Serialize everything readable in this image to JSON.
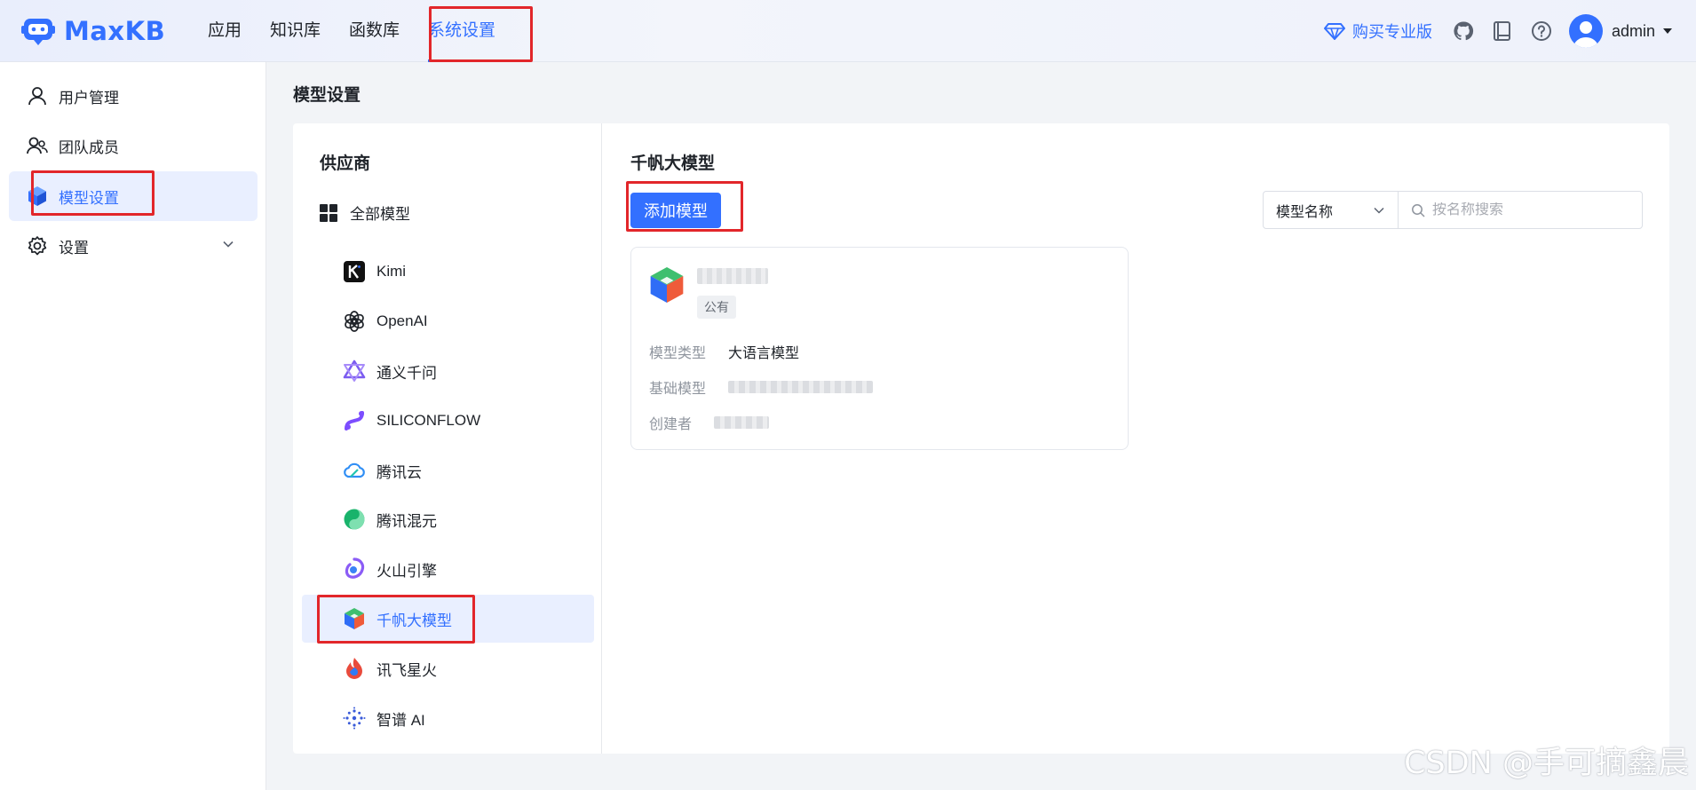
{
  "app": {
    "logo_text": "MaxKB"
  },
  "topnav": {
    "items": [
      {
        "label": "应用"
      },
      {
        "label": "知识库"
      },
      {
        "label": "函数库"
      },
      {
        "label": "系统设置",
        "active": true
      }
    ]
  },
  "header_right": {
    "buy_label": "购买专业版",
    "user_name": "admin",
    "icons": [
      "diamond-icon",
      "github-icon",
      "book-icon",
      "help-icon",
      "avatar-icon",
      "caret-down-icon"
    ]
  },
  "sidebar": {
    "items": [
      {
        "label": "用户管理",
        "icon": "user-icon"
      },
      {
        "label": "团队成员",
        "icon": "team-icon"
      },
      {
        "label": "模型设置",
        "icon": "cube-icon",
        "active": true
      },
      {
        "label": "设置",
        "icon": "gear-icon",
        "expandable": true
      }
    ]
  },
  "main": {
    "page_title": "模型设置",
    "provider_title": "供应商",
    "all_models_label": "全部模型",
    "providers": [
      {
        "label": "Kimi",
        "icon": "kimi-icon"
      },
      {
        "label": "OpenAI",
        "icon": "openai-icon"
      },
      {
        "label": "通义千问",
        "icon": "tongyi-icon"
      },
      {
        "label": "SILICONFLOW",
        "icon": "siliconflow-icon"
      },
      {
        "label": "腾讯云",
        "icon": "tencent-cloud-icon"
      },
      {
        "label": "腾讯混元",
        "icon": "hunyuan-icon"
      },
      {
        "label": "火山引擎",
        "icon": "volcengine-icon"
      },
      {
        "label": "千帆大模型",
        "icon": "qianfan-icon",
        "active": true
      },
      {
        "label": "讯飞星火",
        "icon": "spark-icon"
      },
      {
        "label": "智谱 AI",
        "icon": "zhipu-icon"
      }
    ],
    "content_title": "千帆大模型",
    "add_button_label": "添加模型",
    "filter": {
      "select_value": "模型名称",
      "search_placeholder": "按名称搜索"
    },
    "model_card": {
      "badge": "公有",
      "type_label": "模型类型",
      "type_value": "大语言模型",
      "base_label": "基础模型",
      "creator_label": "创建者"
    }
  },
  "watermark": "CSDN @手可摘鑫晨",
  "colors": {
    "accent": "#3370ff",
    "highlight_box": "#e2262a"
  }
}
